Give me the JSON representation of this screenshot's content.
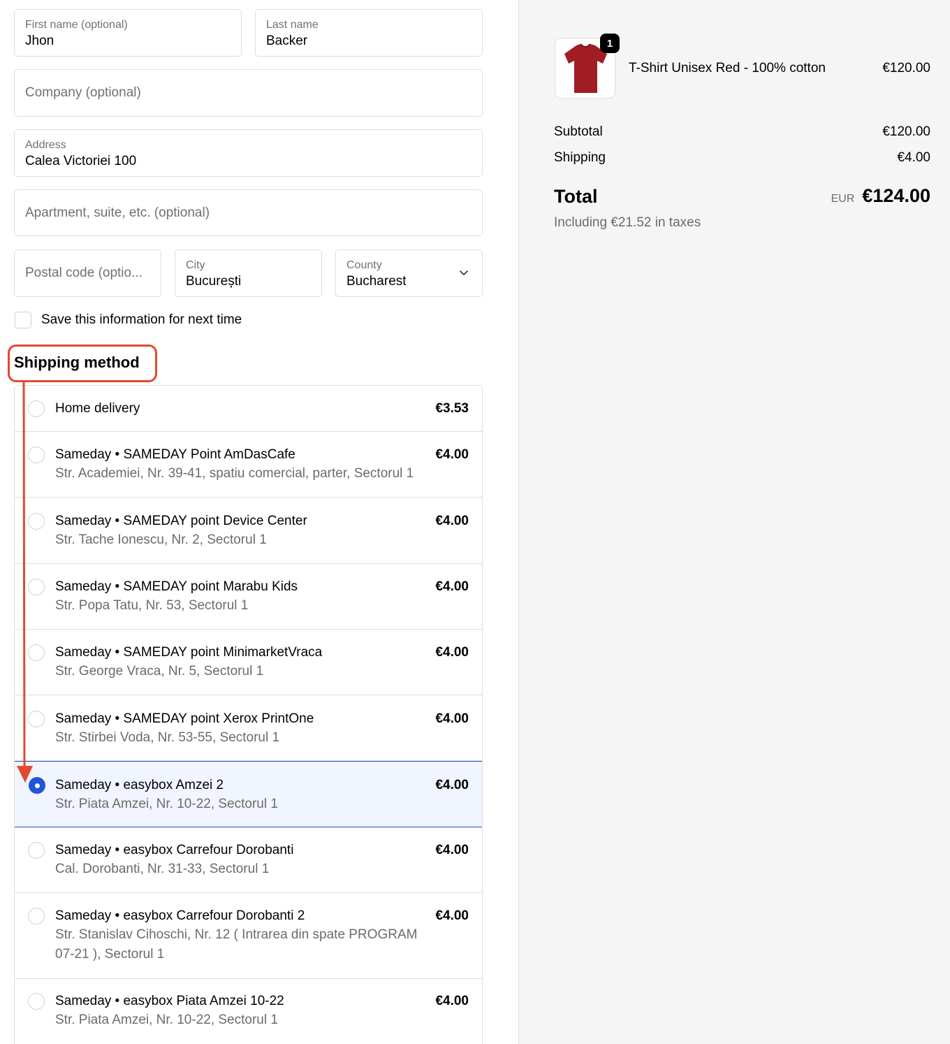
{
  "form": {
    "first_name": {
      "label": "First name (optional)",
      "value": "Jhon"
    },
    "last_name": {
      "label": "Last name",
      "value": "Backer"
    },
    "company": {
      "placeholder": "Company (optional)"
    },
    "address": {
      "label": "Address",
      "value": "Calea Victoriei 100"
    },
    "apartment": {
      "placeholder": "Apartment, suite, etc. (optional)"
    },
    "postal_code": {
      "placeholder": "Postal code (optio..."
    },
    "city": {
      "label": "City",
      "value": "București"
    },
    "county": {
      "label": "County",
      "value": "Bucharest",
      "icon": "chevron-down-icon"
    },
    "save_info": {
      "label": "Save this information for next time",
      "checked": false
    }
  },
  "shipping": {
    "heading": "Shipping method",
    "options": [
      {
        "title": "Home delivery",
        "sub": "",
        "price": "€3.53",
        "selected": false
      },
      {
        "title": "Sameday • SAMEDAY Point AmDasCafe",
        "sub": "Str. Academiei, Nr. 39-41, spatiu comercial, parter, Sectorul 1",
        "price": "€4.00",
        "selected": false
      },
      {
        "title": "Sameday • SAMEDAY point Device Center",
        "sub": "Str. Tache Ionescu, Nr. 2, Sectorul 1",
        "price": "€4.00",
        "selected": false
      },
      {
        "title": "Sameday • SAMEDAY point Marabu Kids",
        "sub": "Str. Popa Tatu, Nr. 53, Sectorul 1",
        "price": "€4.00",
        "selected": false
      },
      {
        "title": "Sameday • SAMEDAY point MinimarketVraca",
        "sub": "Str. George Vraca, Nr. 5, Sectorul 1",
        "price": "€4.00",
        "selected": false
      },
      {
        "title": "Sameday • SAMEDAY point Xerox PrintOne",
        "sub": "Str. Stirbei Voda, Nr. 53-55, Sectorul 1",
        "price": "€4.00",
        "selected": false
      },
      {
        "title": "Sameday • easybox Amzei 2",
        "sub": "Str. Piata Amzei, Nr. 10-22, Sectorul 1",
        "price": "€4.00",
        "selected": true
      },
      {
        "title": "Sameday • easybox Carrefour Dorobanti",
        "sub": "Cal. Dorobanti, Nr. 31-33, Sectorul 1",
        "price": "€4.00",
        "selected": false
      },
      {
        "title": "Sameday • easybox Carrefour Dorobanti 2",
        "sub": "Str. Stanislav Cihoschi, Nr. 12 ( Intrarea din spate PROGRAM 07-21 ), Sectorul 1",
        "price": "€4.00",
        "selected": false
      },
      {
        "title": "Sameday • easybox Piata Amzei 10-22",
        "sub": "Str. Piata Amzei, Nr. 10-22, Sectorul 1",
        "price": "€4.00",
        "selected": false
      }
    ]
  },
  "summary": {
    "product": {
      "name": "T-Shirt Unisex Red - 100% cotton",
      "price": "€120.00",
      "quantity": "1",
      "image_icon": "red-tshirt-icon"
    },
    "subtotal_label": "Subtotal",
    "subtotal_value": "€120.00",
    "shipping_label": "Shipping",
    "shipping_value": "€4.00",
    "total_label": "Total",
    "total_currency": "EUR",
    "total_value": "€124.00",
    "taxes_note": "Including €21.52 in taxes"
  },
  "colors": {
    "accent": "#1f55d6",
    "annotation": "#e04a32",
    "sidebar_bg": "#f5f5f5"
  }
}
